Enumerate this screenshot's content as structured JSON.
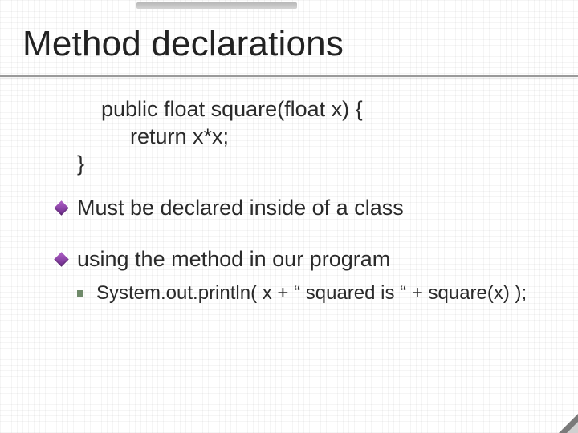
{
  "title": "Method declarations",
  "code": {
    "line1": "public float square(float x) {",
    "line2": "return x*x;",
    "line3": "}"
  },
  "bullets": {
    "b1": "Must be declared inside of a class",
    "b2": "using the method in our program"
  },
  "sub": {
    "s1": "System.out.println( x + “ squared is “ + square(x) );"
  }
}
